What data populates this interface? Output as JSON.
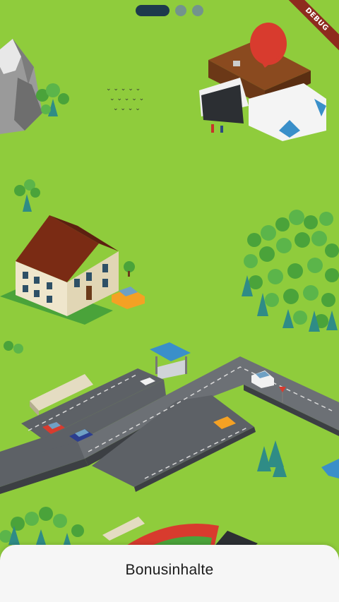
{
  "pager": {
    "pages": 3,
    "active_index": 0
  },
  "debug_banner": {
    "label": "DEBUG",
    "color": "#8e2b1e"
  },
  "map": {
    "background_color": "#8fcc3c",
    "road_color": "#5d6166",
    "accent_location_pin": "#d83b2e"
  },
  "bottom_sheet": {
    "title": "Bonusinhalte"
  }
}
